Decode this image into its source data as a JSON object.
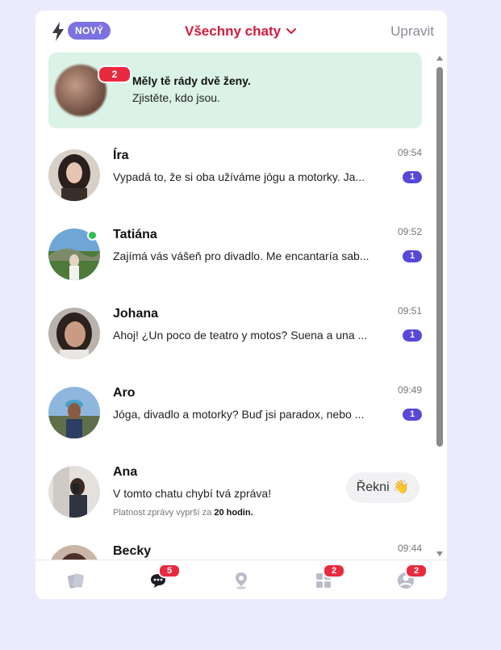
{
  "header": {
    "badge": "NOVÝ",
    "title": "Všechny chaty",
    "edit": "Upravit"
  },
  "promo": {
    "count": "2",
    "line1": "Měly tě rády dvě ženy.",
    "line2": "Zjistěte, kdo jsou."
  },
  "chats": [
    {
      "name": "Íra",
      "time": "09:54",
      "message": "Vypadá to, že si oba užíváme jógu a motorky. Ja...",
      "unread": "1"
    },
    {
      "name": "Tatiána",
      "time": "09:52",
      "message": "Zajímá vás vášeň pro divadlo. Me encantaría sab...",
      "unread": "1"
    },
    {
      "name": "Johana",
      "time": "09:51",
      "message": "Ahoj! ¿Un poco de teatro y motos? Suena a una ...",
      "unread": "1"
    },
    {
      "name": "Aro",
      "time": "09:49",
      "message": "Jóga, divadlo a motorky? Buď jsi paradox, nebo ...",
      "unread": "1"
    },
    {
      "name": "Ana",
      "message": "V tomto chatu chybí tvá zpráva!",
      "expire_prefix": "Platnost zprávy vyprší za",
      "expire_value": "20 hodin.",
      "reply": "Řekni 👋"
    },
    {
      "name": "Becky",
      "time": "09:44"
    }
  ],
  "tabs": {
    "chats_badge": "5",
    "discover_badge": "2",
    "profile_badge": "2"
  },
  "colors": {
    "accent_red": "#d61a3c",
    "badge_purple": "#7b72e0",
    "unread_blue": "#5648d8",
    "promo_bg": "#dbf3e6",
    "page_bg": "#ecebfd"
  }
}
